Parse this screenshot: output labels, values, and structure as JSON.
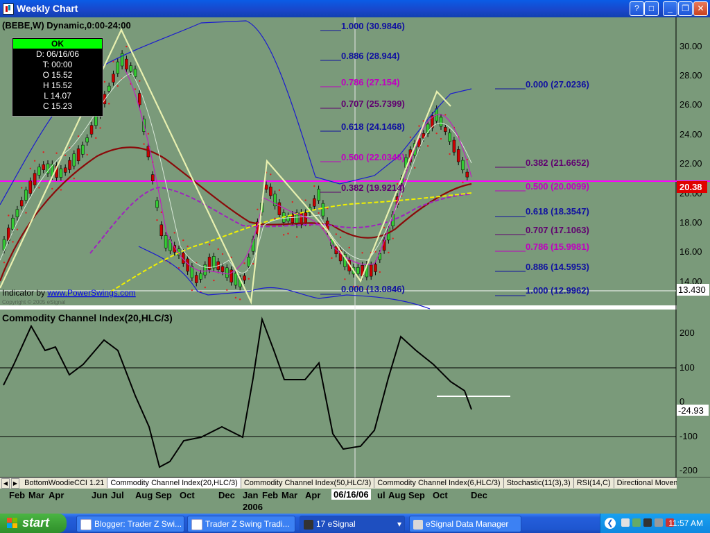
{
  "window": {
    "title": "Weekly Chart"
  },
  "window_buttons": {
    "help": "?",
    "restore": "□",
    "minimize": "_",
    "maximize": "❐",
    "close": "✕"
  },
  "chart": {
    "heading": "(BEBE,W) Dynamic,0:00-24:00",
    "indicator_by": "Indicator by ",
    "indicator_link": "www.PowerSwings.com",
    "copyright": "Copyright © 2005 eSignal",
    "price_axis": [
      "30.00",
      "28.00",
      "26.00",
      "24.00",
      "22.00",
      "20.00",
      "18.00",
      "16.00",
      "14.00"
    ],
    "last_price": "20.38",
    "ref_price": "13.430",
    "fib_left": [
      "1.000 (30.9846)",
      "0.886 (28.944)",
      "0.786 (27.154)",
      "0.707 (25.7399)",
      "0.618 (24.1468)",
      "0.500 (22.0346)",
      "0.382 (19.9214)",
      "0.000 (13.0846)"
    ],
    "fib_right": [
      "0.000 (27.0236)",
      "0.382 (21.6652)",
      "0.500 (20.0099)",
      "0.618 (18.3547)",
      "0.707 (17.1063)",
      "0.786 (15.9981)",
      "0.886 (14.5953)",
      "1.000 (12.9962)"
    ],
    "colors": {
      "navy": "#1010a0",
      "magenta": "#c000c0",
      "purple": "#600070",
      "price_line": "#ff00ff",
      "red_badge": "#e00000"
    }
  },
  "infobox": {
    "status": "OK",
    "date": "D: 06/16/06",
    "time": "T: 00:00",
    "open": "O 15.52",
    "high": "H 15.52",
    "low": "L 14.07",
    "close": "C 15.23"
  },
  "cci": {
    "title": "Commodity Channel Index(20,HLC/3)",
    "axis": [
      "200",
      "100",
      "0",
      "-100",
      "-200"
    ],
    "current": "-24.93"
  },
  "tabs": {
    "items": [
      "BottomWoodieCCI 1.21",
      "Commodity Channel Index(20,HLC/3)",
      "Commodity Channel Index(50,HLC/3)",
      "Commodity Channel Index(6,HLC/3)",
      "Stochastic(11(3),3)",
      "RSI(14,C)",
      "Directional Movement"
    ]
  },
  "dateaxis": {
    "months": [
      "Feb",
      "Mar",
      "Apr",
      "Jun",
      "Jul",
      "Aug",
      "Sep",
      "Oct",
      "Dec",
      "Jan",
      "Feb",
      "Mar",
      "Apr",
      "Aug",
      "Sep",
      "Oct",
      "Dec"
    ],
    "year": "2006",
    "cursor_date": "06/16/06",
    "cursor_fragment": "ul"
  },
  "taskbar": {
    "start": "start",
    "tasks": [
      "Blogger: Trader Z Swi...",
      "Trader Z Swing Tradi...",
      "17 eSignal",
      "eSignal Data Manager"
    ],
    "clock": "11:57 AM"
  }
}
